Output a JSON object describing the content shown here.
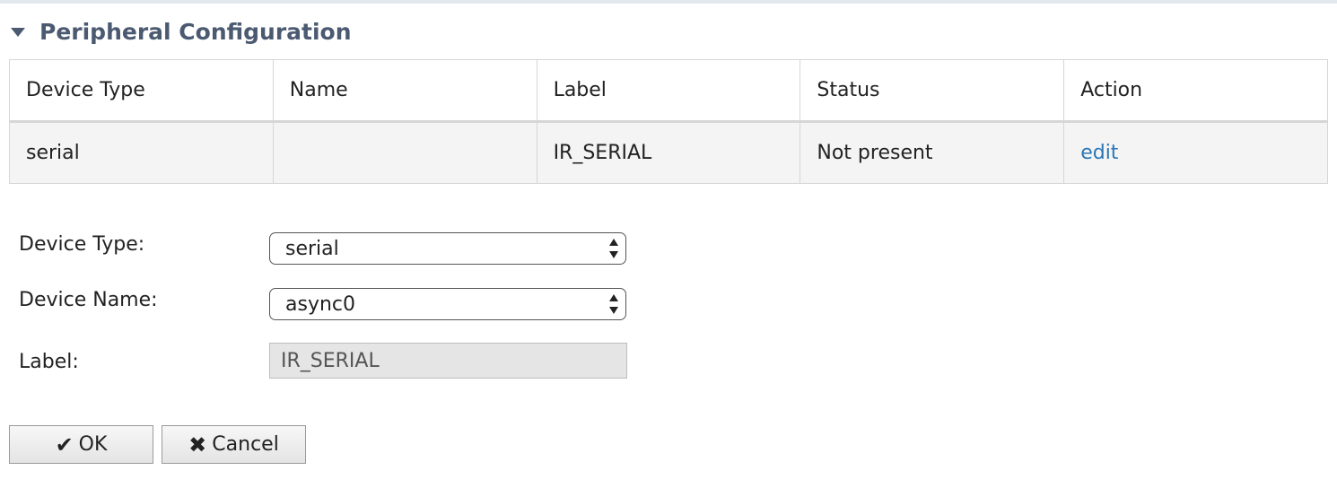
{
  "section": {
    "title": "Peripheral Configuration",
    "toggle_icon": "caret-down-icon"
  },
  "table": {
    "headers": [
      "Device Type",
      "Name",
      "Label",
      "Status",
      "Action"
    ],
    "rows": [
      {
        "device_type": "serial",
        "name": "",
        "label": "IR_SERIAL",
        "status": "Not present",
        "action": "edit"
      }
    ]
  },
  "form": {
    "device_type_label": "Device Type:",
    "device_type_value": "serial",
    "device_name_label": "Device Name:",
    "device_name_value": "async0",
    "label_label": "Label:",
    "label_value": "IR_SERIAL"
  },
  "buttons": {
    "ok_label": "OK",
    "ok_icon": "check-icon",
    "cancel_label": "Cancel",
    "cancel_icon": "x-icon"
  },
  "colors": {
    "title": "#4b5a71",
    "link": "#2a77b6",
    "row_bg": "#f4f4f4",
    "disabled_input_bg": "#e5e5e5"
  }
}
